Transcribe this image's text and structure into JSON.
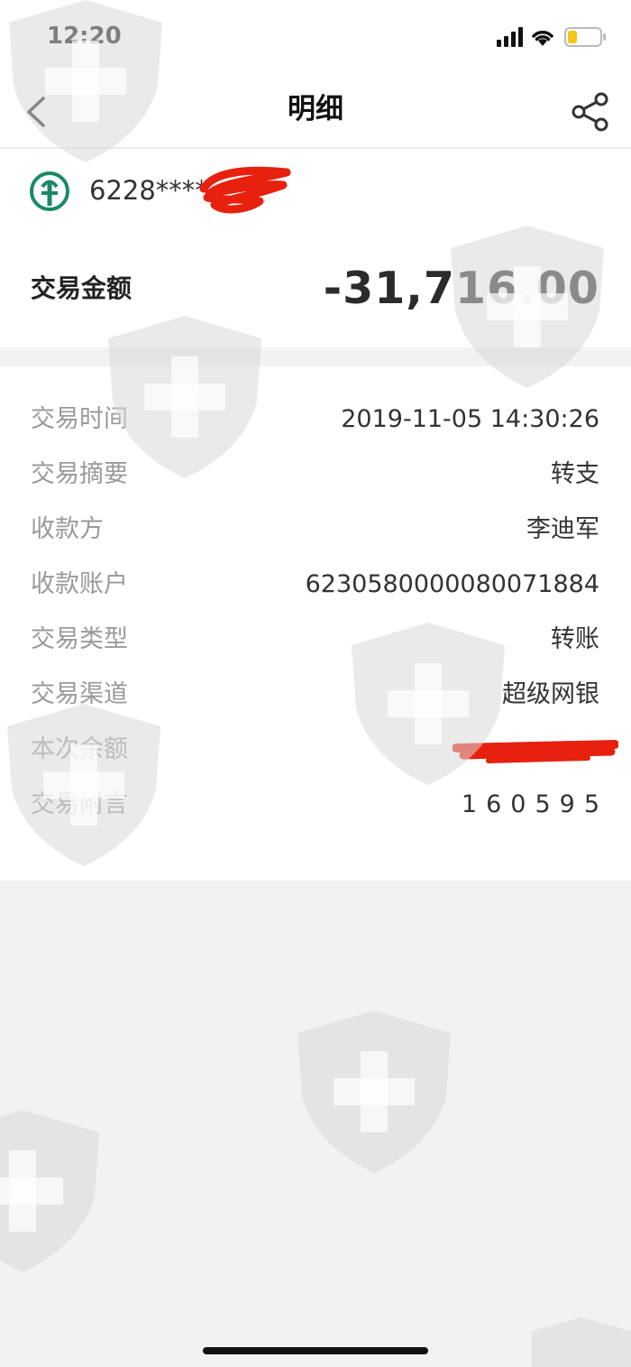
{
  "status_bar": {
    "time": "12:20"
  },
  "nav": {
    "title": "明细",
    "back_icon": "chevron-left-icon",
    "share_icon": "share-icon"
  },
  "account": {
    "bank_logo": "abc-bank-logo-icon",
    "number_prefix": "6228****",
    "amount_label": "交易金额",
    "amount_value": "-31,716.00"
  },
  "details": [
    {
      "label": "交易时间",
      "value": "2019-11-05 14:30:26"
    },
    {
      "label": "交易摘要",
      "value": "转支"
    },
    {
      "label": "收款方",
      "value": "李迪军"
    },
    {
      "label": "收款账户",
      "value": "6230580000080071884"
    },
    {
      "label": "交易类型",
      "value": "转账"
    },
    {
      "label": "交易渠道",
      "value": "超级网银"
    },
    {
      "label": "本次余额",
      "value": ""
    },
    {
      "label": "交易附言",
      "value": "160595"
    }
  ],
  "colors": {
    "bank_green": "#1a8a62",
    "redaction_red": "#e8200e",
    "watermark_gray": "#d4d4d4"
  }
}
